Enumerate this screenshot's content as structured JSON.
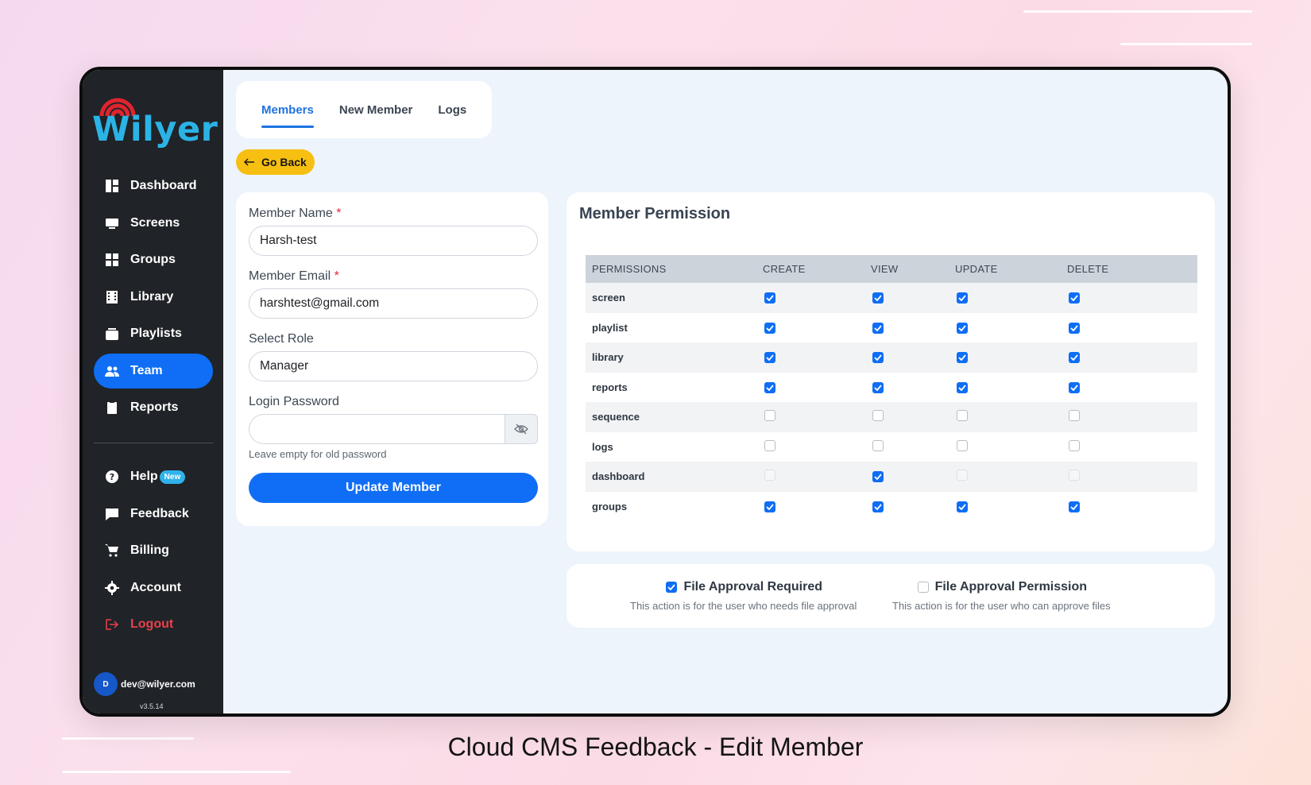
{
  "brand": {
    "name": "Wilyer",
    "signal_color": "#e0242f",
    "text_color": "#2bb3e6"
  },
  "sidebar": {
    "items": [
      {
        "label": "Dashboard",
        "icon": "dashboard-icon"
      },
      {
        "label": "Screens",
        "icon": "monitor-icon"
      },
      {
        "label": "Groups",
        "icon": "grid-icon"
      },
      {
        "label": "Library",
        "icon": "film-icon"
      },
      {
        "label": "Playlists",
        "icon": "playlist-icon"
      },
      {
        "label": "Team",
        "icon": "team-icon",
        "active": true
      },
      {
        "label": "Reports",
        "icon": "report-icon"
      }
    ],
    "bottom_items": [
      {
        "label": "Help",
        "icon": "help-icon",
        "badge": "New"
      },
      {
        "label": "Feedback",
        "icon": "feedback-icon"
      },
      {
        "label": "Billing",
        "icon": "cart-icon"
      },
      {
        "label": "Account",
        "icon": "gear-icon"
      },
      {
        "label": "Logout",
        "icon": "logout-icon"
      }
    ],
    "user": {
      "initial": "D",
      "email": "dev@wilyer.com"
    },
    "version": "v3.5.14"
  },
  "tabs": [
    {
      "label": "Members",
      "active": true
    },
    {
      "label": "New Member"
    },
    {
      "label": "Logs"
    }
  ],
  "go_back_label": "Go Back",
  "form": {
    "name_label": "Member Name",
    "name_value": "Harsh-test",
    "email_label": "Member Email",
    "email_value": "harshtest@gmail.com",
    "role_label": "Select Role",
    "role_value": "Manager",
    "password_label": "Login Password",
    "password_value": "",
    "password_hint": "Leave empty for old password",
    "submit_label": "Update Member",
    "required_mark": "*"
  },
  "permissions": {
    "title": "Member Permission",
    "headers": [
      "PERMISSIONS",
      "CREATE",
      "VIEW",
      "UPDATE",
      "DELETE"
    ],
    "rows": [
      {
        "name": "screen",
        "create": "on",
        "view": "on",
        "update": "on",
        "delete": "on"
      },
      {
        "name": "playlist",
        "create": "on",
        "view": "on",
        "update": "on",
        "delete": "on"
      },
      {
        "name": "library",
        "create": "on",
        "view": "on",
        "update": "on",
        "delete": "on"
      },
      {
        "name": "reports",
        "create": "on",
        "view": "on",
        "update": "on",
        "delete": "on"
      },
      {
        "name": "sequence",
        "create": "off",
        "view": "off",
        "update": "off",
        "delete": "off"
      },
      {
        "name": "logs",
        "create": "off",
        "view": "off",
        "update": "off",
        "delete": "off"
      },
      {
        "name": "dashboard",
        "create": "disabled",
        "view": "on",
        "update": "disabled",
        "delete": "disabled"
      },
      {
        "name": "groups",
        "create": "on",
        "view": "on",
        "update": "on",
        "delete": "on"
      }
    ]
  },
  "approval": {
    "required": {
      "label": "File Approval Required",
      "checked": true,
      "desc": "This action is for the user who needs file approval"
    },
    "permission": {
      "label": "File Approval Permission",
      "checked": false,
      "desc": "This action is for the user who can approve files"
    }
  },
  "caption": "Cloud CMS Feedback - Edit Member",
  "colors": {
    "accent": "#0f6ef5",
    "sidebar_bg": "#202327",
    "go_back": "#f6bf11",
    "logout": "#e8414b"
  }
}
